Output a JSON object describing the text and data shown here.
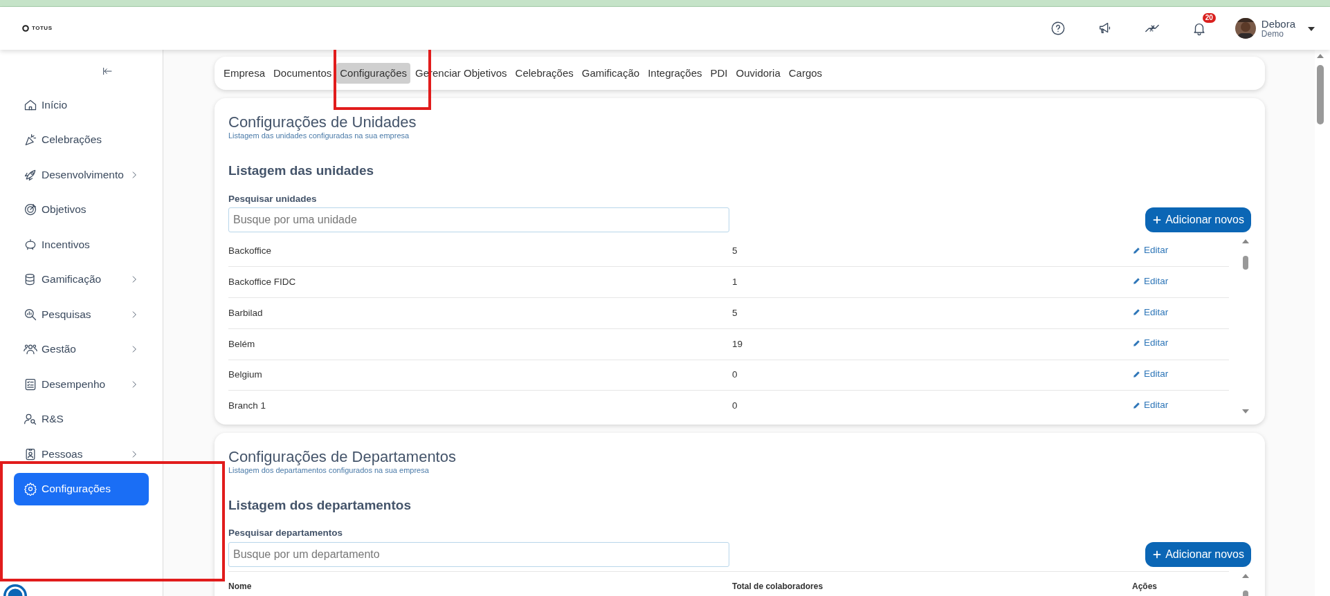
{
  "header": {
    "logo": "TOTUS",
    "notifications_badge": "20",
    "user": {
      "name": "Debora",
      "role": "Demo"
    }
  },
  "sidebar": {
    "items": [
      {
        "label": "Início",
        "kind": "home",
        "submenu": false,
        "selected": false,
        "highlighted": false
      },
      {
        "label": "Celebrações",
        "kind": "party",
        "submenu": false,
        "selected": false,
        "highlighted": false
      },
      {
        "label": "Desenvolvimento",
        "kind": "rocket",
        "submenu": true,
        "selected": false,
        "highlighted": false
      },
      {
        "label": "Objetivos",
        "kind": "target",
        "submenu": false,
        "selected": false,
        "highlighted": false
      },
      {
        "label": "Incentivos",
        "kind": "piggy",
        "submenu": false,
        "selected": false,
        "highlighted": false
      },
      {
        "label": "Gamificação",
        "kind": "coins",
        "submenu": true,
        "selected": false,
        "highlighted": false
      },
      {
        "label": "Pesquisas",
        "kind": "survey",
        "submenu": true,
        "selected": false,
        "highlighted": false
      },
      {
        "label": "Gestão",
        "kind": "people",
        "submenu": true,
        "selected": false,
        "highlighted": false
      },
      {
        "label": "Desempenho",
        "kind": "checklist",
        "submenu": true,
        "selected": false,
        "highlighted": false
      },
      {
        "label": "R&S",
        "kind": "usersearch",
        "submenu": false,
        "selected": false,
        "highlighted": false
      },
      {
        "label": "Pessoas",
        "kind": "badge",
        "submenu": true,
        "selected": false,
        "highlighted": false
      },
      {
        "label": "Configurações",
        "kind": "gear",
        "submenu": false,
        "selected": true,
        "highlighted": true
      }
    ]
  },
  "tabs": [
    {
      "label": "Empresa",
      "selected": false,
      "highlighted": false
    },
    {
      "label": "Documentos",
      "selected": false,
      "highlighted": false
    },
    {
      "label": "Configurações",
      "selected": true,
      "highlighted": true
    },
    {
      "label": "Gerenciar Objetivos",
      "selected": false,
      "highlighted": false
    },
    {
      "label": "Celebrações",
      "selected": false,
      "highlighted": false
    },
    {
      "label": "Gamificação",
      "selected": false,
      "highlighted": false
    },
    {
      "label": "Integrações",
      "selected": false,
      "highlighted": false
    },
    {
      "label": "PDI",
      "selected": false,
      "highlighted": false
    },
    {
      "label": "Ouvidoria",
      "selected": false,
      "highlighted": false
    },
    {
      "label": "Cargos",
      "selected": false,
      "highlighted": false
    }
  ],
  "sections": [
    {
      "title": "Configurações de Unidades",
      "subtitle": "Listagem das unidades configuradas na sua empresa",
      "list_title": "Listagem das unidades",
      "search_label": "Pesquisar unidades",
      "search_placeholder": "Busque por uma unidade",
      "add_button": "Adicionar novos",
      "table": {
        "rows": [
          {
            "name": "Backoffice",
            "count": "5",
            "action": "Editar"
          },
          {
            "name": "Backoffice FIDC",
            "count": "1",
            "action": "Editar"
          },
          {
            "name": "Barbilad",
            "count": "5",
            "action": "Editar"
          },
          {
            "name": "Belém",
            "count": "19",
            "action": "Editar"
          },
          {
            "name": "Belgium",
            "count": "0",
            "action": "Editar"
          },
          {
            "name": "Branch 1",
            "count": "0",
            "action": "Editar"
          }
        ]
      }
    },
    {
      "title": "Configurações de Departamentos",
      "subtitle": "Listagem dos departamentos configurados na sua empresa",
      "list_title": "Listagem dos departamentos",
      "search_label": "Pesquisar departamentos",
      "search_placeholder": "Busque por um departamento",
      "add_button": "Adicionar novos",
      "table": {
        "columns": [
          "Nome",
          "Total de colaboradores",
          "Ações"
        ]
      }
    }
  ]
}
